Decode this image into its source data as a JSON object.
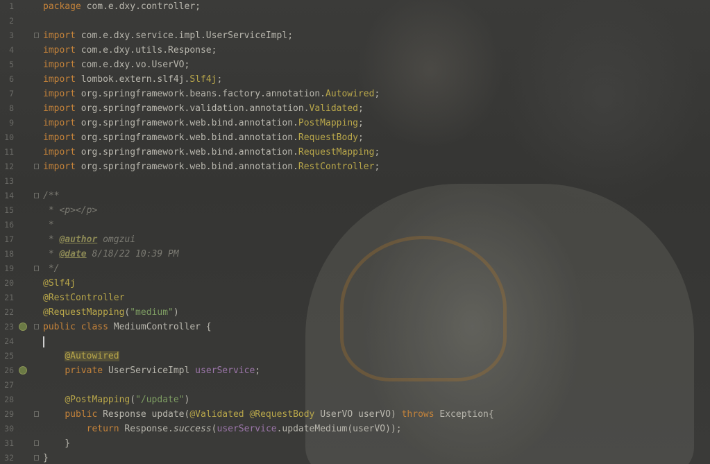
{
  "editor": {
    "lines": [
      {
        "n": "1",
        "segs": [
          {
            "t": "package ",
            "c": "kw"
          },
          {
            "t": "com.e.dxy.controller;"
          }
        ]
      },
      {
        "n": "2",
        "segs": []
      },
      {
        "n": "3",
        "fold": true,
        "segs": [
          {
            "t": "import ",
            "c": "kw"
          },
          {
            "t": "com.e.dxy.service.impl.UserServiceImpl;"
          }
        ]
      },
      {
        "n": "4",
        "segs": [
          {
            "t": "import ",
            "c": "kw"
          },
          {
            "t": "com.e.dxy.utils.Response;"
          }
        ]
      },
      {
        "n": "5",
        "segs": [
          {
            "t": "import ",
            "c": "kw"
          },
          {
            "t": "com.e.dxy.vo.UserVO;"
          }
        ]
      },
      {
        "n": "6",
        "segs": [
          {
            "t": "import ",
            "c": "kw"
          },
          {
            "t": "lombok.extern.slf4j."
          },
          {
            "t": "Slf4j",
            "c": "an"
          },
          {
            "t": ";"
          }
        ]
      },
      {
        "n": "7",
        "segs": [
          {
            "t": "import ",
            "c": "kw"
          },
          {
            "t": "org.springframework.beans.factory.annotation."
          },
          {
            "t": "Autowired",
            "c": "an"
          },
          {
            "t": ";"
          }
        ]
      },
      {
        "n": "8",
        "segs": [
          {
            "t": "import ",
            "c": "kw"
          },
          {
            "t": "org.springframework.validation.annotation."
          },
          {
            "t": "Validated",
            "c": "an"
          },
          {
            "t": ";"
          }
        ]
      },
      {
        "n": "9",
        "segs": [
          {
            "t": "import ",
            "c": "kw"
          },
          {
            "t": "org.springframework.web.bind.annotation."
          },
          {
            "t": "PostMapping",
            "c": "an"
          },
          {
            "t": ";"
          }
        ]
      },
      {
        "n": "10",
        "segs": [
          {
            "t": "import ",
            "c": "kw"
          },
          {
            "t": "org.springframework.web.bind.annotation."
          },
          {
            "t": "RequestBody",
            "c": "an"
          },
          {
            "t": ";"
          }
        ]
      },
      {
        "n": "11",
        "segs": [
          {
            "t": "import ",
            "c": "kw"
          },
          {
            "t": "org.springframework.web.bind.annotation."
          },
          {
            "t": "RequestMapping",
            "c": "an"
          },
          {
            "t": ";"
          }
        ]
      },
      {
        "n": "12",
        "fold": true,
        "segs": [
          {
            "t": "import ",
            "c": "kw"
          },
          {
            "t": "org.springframework.web.bind.annotation."
          },
          {
            "t": "RestController",
            "c": "an"
          },
          {
            "t": ";"
          }
        ]
      },
      {
        "n": "13",
        "segs": []
      },
      {
        "n": "14",
        "fold": true,
        "segs": [
          {
            "t": "/**",
            "c": "cm"
          }
        ]
      },
      {
        "n": "15",
        "segs": [
          {
            "t": " * ",
            "c": "cm"
          },
          {
            "t": "<p></p>",
            "c": "cm"
          }
        ]
      },
      {
        "n": "16",
        "segs": [
          {
            "t": " *",
            "c": "cm"
          }
        ]
      },
      {
        "n": "17",
        "segs": [
          {
            "t": " * ",
            "c": "cm"
          },
          {
            "t": "@author",
            "c": "tag"
          },
          {
            "t": " omgzui",
            "c": "cm"
          }
        ]
      },
      {
        "n": "18",
        "segs": [
          {
            "t": " * ",
            "c": "cm"
          },
          {
            "t": "@date",
            "c": "tag"
          },
          {
            "t": " 8/18/22 10:39 PM",
            "c": "cm"
          }
        ]
      },
      {
        "n": "19",
        "fold": true,
        "segs": [
          {
            "t": " */",
            "c": "cm"
          }
        ]
      },
      {
        "n": "20",
        "segs": [
          {
            "t": "@Slf4j",
            "c": "an"
          }
        ]
      },
      {
        "n": "21",
        "segs": [
          {
            "t": "@RestController",
            "c": "an"
          }
        ]
      },
      {
        "n": "22",
        "segs": [
          {
            "t": "@RequestMapping",
            "c": "an"
          },
          {
            "t": "("
          },
          {
            "t": "\"medium\"",
            "c": "st"
          },
          {
            "t": ")"
          }
        ]
      },
      {
        "n": "23",
        "fold": true,
        "icon": "bean-icon",
        "segs": [
          {
            "t": "public class ",
            "c": "kw"
          },
          {
            "t": "MediumController {"
          }
        ]
      },
      {
        "n": "24",
        "caret": true,
        "segs": []
      },
      {
        "n": "25",
        "segs": [
          {
            "t": "    "
          },
          {
            "t": "@Autowired",
            "c": "an hl"
          }
        ]
      },
      {
        "n": "26",
        "icon": "bean-icon",
        "segs": [
          {
            "t": "    "
          },
          {
            "t": "private ",
            "c": "kw"
          },
          {
            "t": "UserServiceImpl "
          },
          {
            "t": "userService",
            "c": "fld"
          },
          {
            "t": ";"
          }
        ]
      },
      {
        "n": "27",
        "segs": []
      },
      {
        "n": "28",
        "segs": [
          {
            "t": "    "
          },
          {
            "t": "@PostMapping",
            "c": "an"
          },
          {
            "t": "("
          },
          {
            "t": "\"/update\"",
            "c": "st"
          },
          {
            "t": ")"
          }
        ]
      },
      {
        "n": "29",
        "fold": true,
        "segs": [
          {
            "t": "    "
          },
          {
            "t": "public ",
            "c": "kw"
          },
          {
            "t": "Response update("
          },
          {
            "t": "@Validated",
            "c": "an"
          },
          {
            "t": " "
          },
          {
            "t": "@RequestBody",
            "c": "an"
          },
          {
            "t": " UserVO userVO) "
          },
          {
            "t": "throws ",
            "c": "kw"
          },
          {
            "t": "Exception{"
          }
        ]
      },
      {
        "n": "30",
        "segs": [
          {
            "t": "        "
          },
          {
            "t": "return ",
            "c": "kw"
          },
          {
            "t": "Response."
          },
          {
            "t": "success",
            "c": "it"
          },
          {
            "t": "("
          },
          {
            "t": "userService",
            "c": "fld"
          },
          {
            "t": ".updateMedium(userVO));"
          }
        ]
      },
      {
        "n": "31",
        "fold": true,
        "segs": [
          {
            "t": "    }"
          }
        ]
      },
      {
        "n": "32",
        "fold": true,
        "segs": [
          {
            "t": "}"
          }
        ]
      }
    ]
  }
}
